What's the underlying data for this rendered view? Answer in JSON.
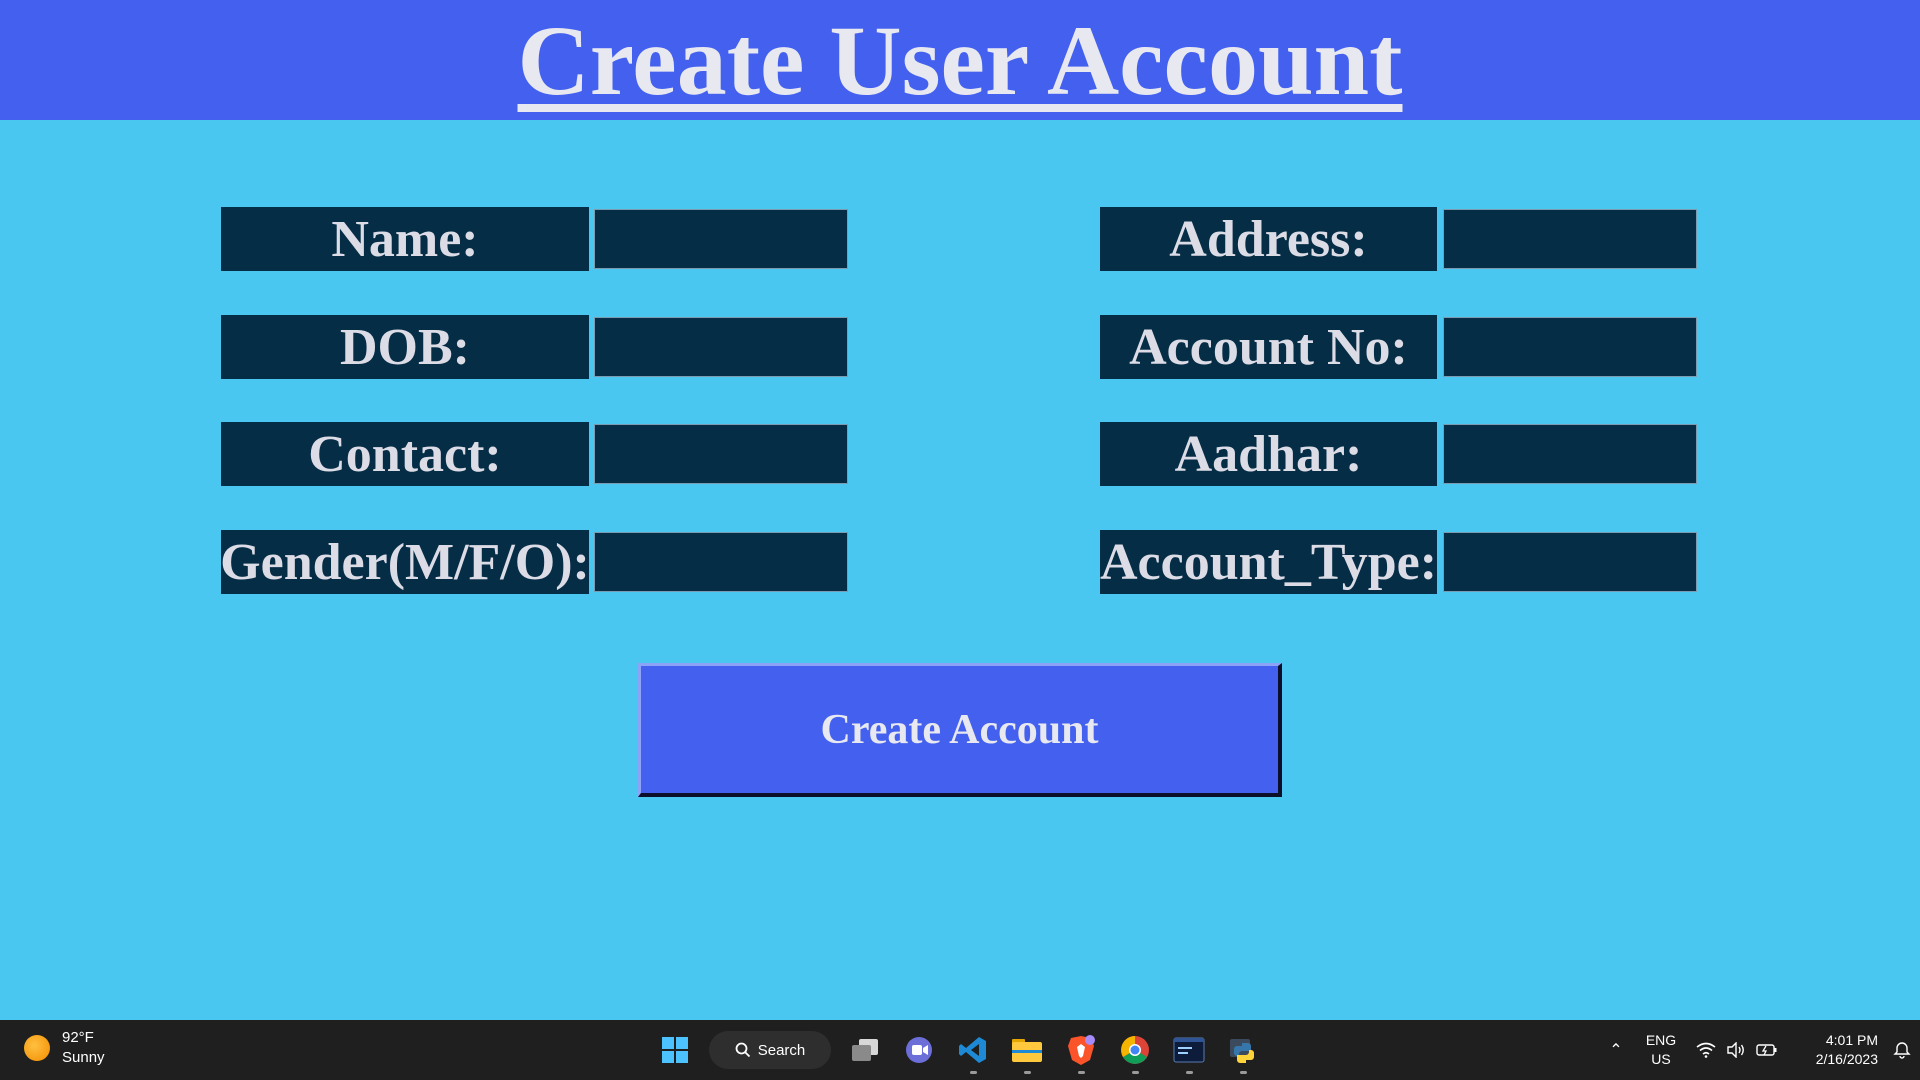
{
  "header": {
    "title": "Create User Account",
    "bg_color": "#4361EE"
  },
  "form": {
    "left": [
      {
        "label": "Name:",
        "value": ""
      },
      {
        "label": "DOB:",
        "value": ""
      },
      {
        "label": "Contact:",
        "value": ""
      },
      {
        "label": "Gender(M/F/O):",
        "value": ""
      }
    ],
    "right": [
      {
        "label": "Address:",
        "value": ""
      },
      {
        "label": "Account No:",
        "value": ""
      },
      {
        "label": "Aadhar:",
        "value": ""
      },
      {
        "label": "Account_Type:",
        "value": ""
      }
    ],
    "submit_label": "Create Account",
    "field_color": "#062D46",
    "bg_color": "#4AC7F0"
  },
  "taskbar": {
    "weather": {
      "temp": "92°F",
      "condition": "Sunny",
      "icon": "sun-icon"
    },
    "search_label": "Search",
    "pinned": [
      "start-icon",
      "search",
      "task-view-icon",
      "chat-icon",
      "vscode-icon",
      "file-explorer-icon",
      "brave-icon",
      "chrome-icon",
      "terminal-icon",
      "python-icon"
    ],
    "tray": {
      "lang_line1": "ENG",
      "lang_line2": "US",
      "time": "4:01 PM",
      "date": "2/16/2023"
    }
  }
}
